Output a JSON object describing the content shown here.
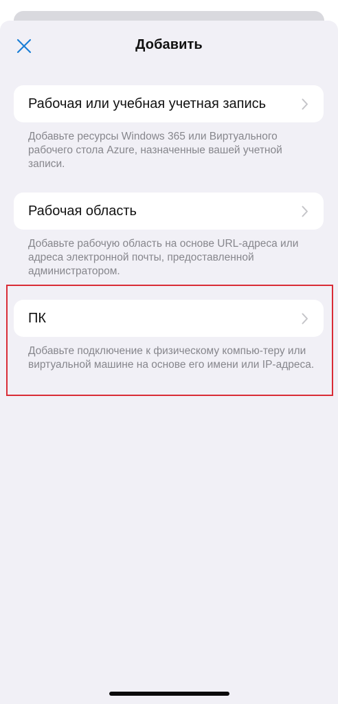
{
  "header": {
    "title": "Добавить",
    "close_icon": "close-icon"
  },
  "options": [
    {
      "label": "Рабочая или учебная учетная запись",
      "description": "Добавьте ресурсы Windows 365 или Виртуального рабочего стола Azure, назначенные вашей учетной записи."
    },
    {
      "label": "Рабочая область",
      "description": "Добавьте рабочую область на основе URL-адреса или адреса электронной почты, предоставленной администратором."
    },
    {
      "label": "ПК",
      "description": "Добавьте подключение к физическому компью-теру или виртуальной машине на основе его имени или IP-адреса."
    }
  ],
  "colors": {
    "accent": "#1a7fd6",
    "sheet_background": "#f1f0f6",
    "highlight_border": "#d92b35"
  }
}
